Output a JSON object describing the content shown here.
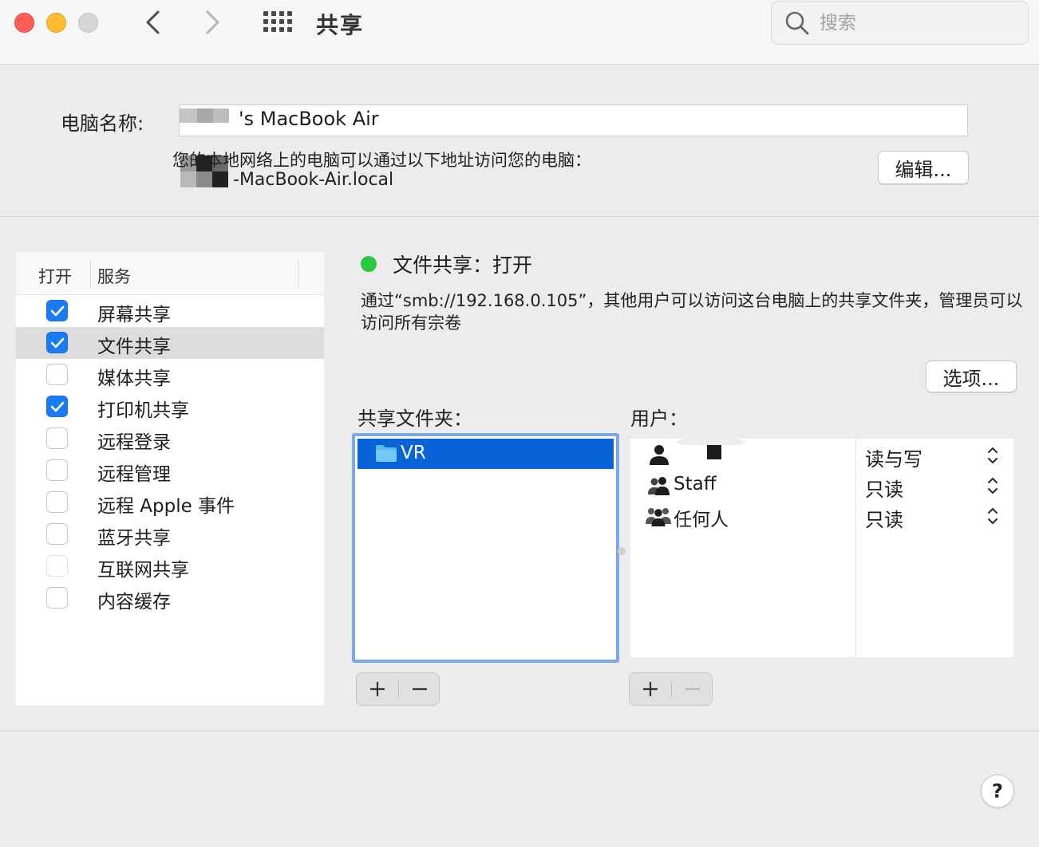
{
  "window": {
    "title": "共享",
    "search_placeholder": "搜索"
  },
  "computer": {
    "name_label": "电脑名称:",
    "name_value": "'s MacBook Air",
    "local_desc": "您的本地网络上的电脑可以通过以下地址访问您的电脑：",
    "local_address": "-MacBook-Air.local",
    "edit_label": "编辑..."
  },
  "services": {
    "header_on": "打开",
    "header_service": "服务",
    "items": [
      {
        "label": "屏幕共享",
        "checked": true
      },
      {
        "label": "文件共享",
        "checked": true,
        "selected": true
      },
      {
        "label": "媒体共享",
        "checked": false
      },
      {
        "label": "打印机共享",
        "checked": true
      },
      {
        "label": "远程登录",
        "checked": false
      },
      {
        "label": "远程管理",
        "checked": false
      },
      {
        "label": "远程 Apple 事件",
        "checked": false
      },
      {
        "label": "蓝牙共享",
        "checked": false
      },
      {
        "label": "互联网共享",
        "checked": false
      },
      {
        "label": "内容缓存",
        "checked": false
      }
    ]
  },
  "file_sharing": {
    "status": "文件共享：打开",
    "status_color": "#28c840",
    "description": "通过“smb://192.168.0.105”，其他用户可以访问这台电脑上的共享文件夹，管理员可以访问所有宗卷",
    "options_label": "选项...",
    "folders_label": "共享文件夹：",
    "users_label": "用户：",
    "folders": [
      {
        "name": "VR"
      }
    ],
    "users": [
      {
        "name": "",
        "icon": "person-icon",
        "permission": "读与写"
      },
      {
        "name": "Staff",
        "icon": "group-icon",
        "permission": "只读"
      },
      {
        "name": "任何人",
        "icon": "everyone-icon",
        "permission": "只读"
      }
    ],
    "add_label": "+",
    "remove_label": "−"
  },
  "help_label": "?",
  "colors": {
    "accent": "#1a7cf5",
    "selection": "#0a64d8",
    "status_on": "#28c840"
  }
}
